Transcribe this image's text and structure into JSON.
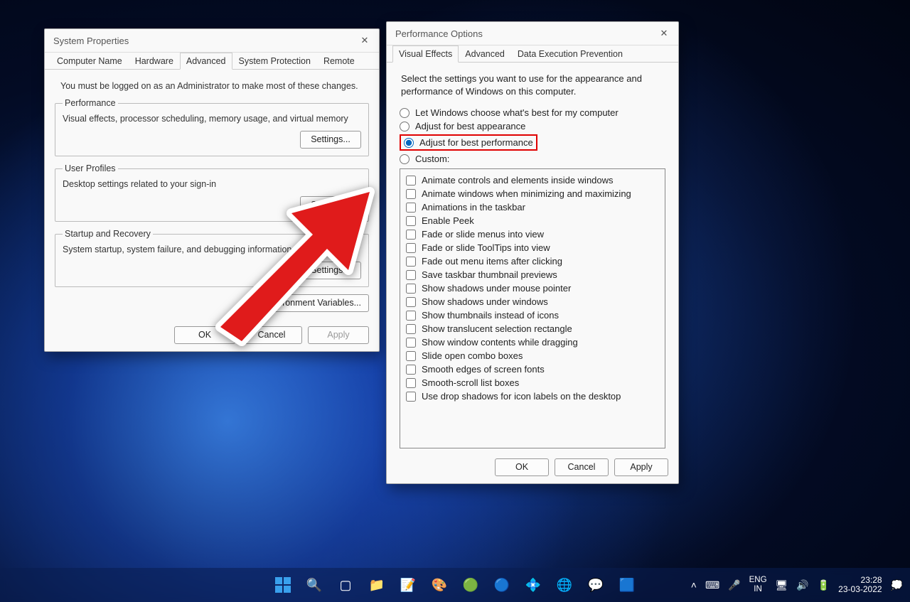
{
  "sysprop": {
    "title": "System Properties",
    "tabs": [
      "Computer Name",
      "Hardware",
      "Advanced",
      "System Protection",
      "Remote"
    ],
    "active_tab": 2,
    "note": "You must be logged on as an Administrator to make most of these changes.",
    "groups": {
      "performance": {
        "legend": "Performance",
        "desc": "Visual effects, processor scheduling, memory usage, and virtual memory",
        "button": "Settings..."
      },
      "userprofiles": {
        "legend": "User Profiles",
        "desc": "Desktop settings related to your sign-in",
        "button": "Settings..."
      },
      "startup": {
        "legend": "Startup and Recovery",
        "desc": "System startup, system failure, and debugging information",
        "button": "Settings..."
      }
    },
    "env_button": "Environment Variables...",
    "footer": {
      "ok": "OK",
      "cancel": "Cancel",
      "apply": "Apply"
    }
  },
  "perfopts": {
    "title": "Performance Options",
    "tabs": [
      "Visual Effects",
      "Advanced",
      "Data Execution Prevention"
    ],
    "active_tab": 0,
    "desc": "Select the settings you want to use for the appearance and performance of Windows on this computer.",
    "radios": [
      "Let Windows choose what's best for my computer",
      "Adjust for best appearance",
      "Adjust for best performance",
      "Custom:"
    ],
    "selected_radio": 2,
    "checks": [
      "Animate controls and elements inside windows",
      "Animate windows when minimizing and maximizing",
      "Animations in the taskbar",
      "Enable Peek",
      "Fade or slide menus into view",
      "Fade or slide ToolTips into view",
      "Fade out menu items after clicking",
      "Save taskbar thumbnail previews",
      "Show shadows under mouse pointer",
      "Show shadows under windows",
      "Show thumbnails instead of icons",
      "Show translucent selection rectangle",
      "Show window contents while dragging",
      "Slide open combo boxes",
      "Smooth edges of screen fonts",
      "Smooth-scroll list boxes",
      "Use drop shadows for icon labels on the desktop"
    ],
    "footer": {
      "ok": "OK",
      "cancel": "Cancel",
      "apply": "Apply"
    }
  },
  "taskbar": {
    "lang1": "ENG",
    "lang2": "IN",
    "time": "23:28",
    "date": "23-03-2022"
  }
}
